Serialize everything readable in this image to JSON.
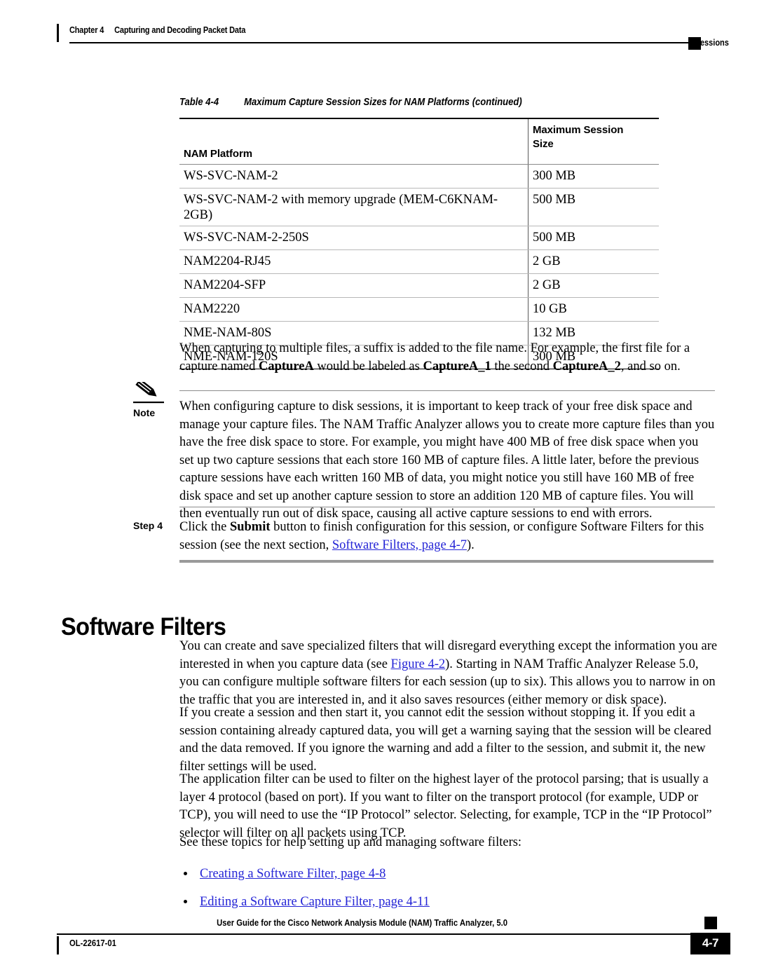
{
  "header": {
    "chapter_number": "Chapter 4",
    "chapter_title": "Capturing and Decoding Packet Data",
    "section": "Sessions"
  },
  "table": {
    "caption_number": "Table 4-4",
    "caption_title": "Maximum Capture Session Sizes for NAM Platforms  (continued)",
    "columns": [
      "NAM Platform",
      "Maximum Session Size"
    ],
    "column_size_line1": "Maximum Session",
    "column_size_line2": "Size",
    "rows": [
      {
        "platform": "WS-SVC-NAM-2",
        "size": "300 MB"
      },
      {
        "platform": "WS-SVC-NAM-2 with memory upgrade (MEM-C6KNAM-2GB)",
        "size": "500 MB"
      },
      {
        "platform": "WS-SVC-NAM-2-250S",
        "size": "500 MB"
      },
      {
        "platform": "NAM2204-RJ45",
        "size": "2 GB"
      },
      {
        "platform": "NAM2204-SFP",
        "size": "2 GB"
      },
      {
        "platform": "NAM2220",
        "size": "10 GB"
      },
      {
        "platform": "NME-NAM-80S",
        "size": "132 MB"
      },
      {
        "platform": "NME-NAM-120S",
        "size": "300 MB"
      }
    ]
  },
  "paragraph_after_table": {
    "t1": "When capturing to multiple files, a suffix is added to the file name. For example, the first file for a capture named ",
    "b1": "CaptureA",
    "t2": " would be labeled as ",
    "b2": "CaptureA_1",
    "t3": " the second ",
    "b3": "CaptureA_2",
    "t4": ", and so on."
  },
  "note": {
    "label": "Note",
    "icon": "pencil-icon",
    "text": "When configuring capture to disk sessions, it is important to keep track of your free disk space and manage your capture files. The NAM Traffic Analyzer allows you to create more capture files than you have the free disk space to store. For example, you might have 400 MB of free disk space when you set up two capture sessions that each store 160 MB of capture files. A little later, before the previous capture sessions have each written 160 MB of data, you might notice you still have 160 MB of free disk space and set up another capture session to store an addition 120 MB of capture files. You will then eventually run out of disk space, causing all active capture sessions to end with errors."
  },
  "step": {
    "label": "Step 4",
    "t1": "Click the ",
    "b1": "Submit",
    "t2": " button to finish configuration for this session, or configure Software Filters for this session (see the next section, ",
    "link": "Software Filters, page 4-7",
    "t3": ")."
  },
  "heading": "Software Filters",
  "paragraphs": {
    "p1_t1": "You can create and save specialized filters that will disregard everything except the information you are interested in when you capture data (see ",
    "p1_link": "Figure 4-2",
    "p1_t2": "). Starting in NAM Traffic Analyzer Release 5.0, you can configure multiple software filters for each session (up to six). This allows you to narrow in on the traffic that you are interested in, and it also saves resources (either memory or disk space).",
    "p2": "If you create a session and then start it, you cannot edit the session without stopping it. If you edit a session containing already captured data, you will get a warning saying that the session will be cleared and the data removed. If you ignore the warning and add a filter to the session, and submit it, the new filter settings will be used.",
    "p3": "The application filter can be used to filter on the highest layer of the protocol parsing; that is usually a layer 4 protocol (based on port). If you want to filter on the transport protocol (for example, UDP or TCP), you will need to use the “IP Protocol” selector. Selecting, for example, TCP in the “IP Protocol” selector will filter on all packets using TCP.",
    "p4": "See these topics for help setting up and managing software filters:"
  },
  "topic_links": [
    "Creating a Software Filter, page 4-8",
    "Editing a Software Capture Filter, page 4-11"
  ],
  "footer": {
    "guide_title": "User Guide for the Cisco Network Analysis Module (NAM) Traffic Analyzer, 5.0",
    "doc_id": "OL-22617-01",
    "page_number": "4-7"
  },
  "colors": {
    "link": "#2424d6",
    "rule_gray": "#9a9a9a",
    "text": "#000000"
  }
}
